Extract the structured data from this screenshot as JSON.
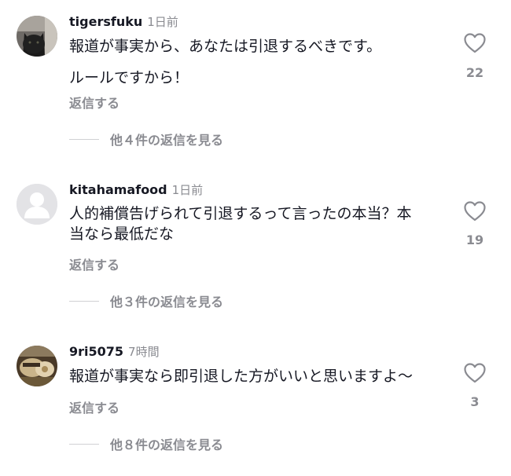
{
  "comments": [
    {
      "username": "tigersfuku",
      "time": "1日前",
      "lines": [
        "報道が事実から、あなたは引退するべきです。",
        "ルールですから！"
      ],
      "reply_label": "返信する",
      "view_replies": "他４件の返信を見る",
      "likes": "22",
      "avatar": "black-cat-photo"
    },
    {
      "username": "kitahamafood",
      "time": "1日前",
      "lines": [
        "人的補償告げられて引退するって言ったの本当？本",
        "当なら最低だな"
      ],
      "reply_label": "返信する",
      "view_replies": "他３件の返信を見る",
      "likes": "19",
      "avatar": "default-user-silhouette"
    },
    {
      "username": "9ri5075",
      "time": "7時間",
      "lines": [
        "報道が事実なら即引退した方がいいと思いますよ〜"
      ],
      "reply_label": "返信する",
      "view_replies": "他８件の返信を見る",
      "likes": "3",
      "avatar": "food-photo"
    }
  ],
  "colors": {
    "primary_text": "#161823",
    "secondary_text": "#8a8b91",
    "divider": "#d0d1d4"
  },
  "icons": {
    "like": "heart-outline-icon"
  }
}
